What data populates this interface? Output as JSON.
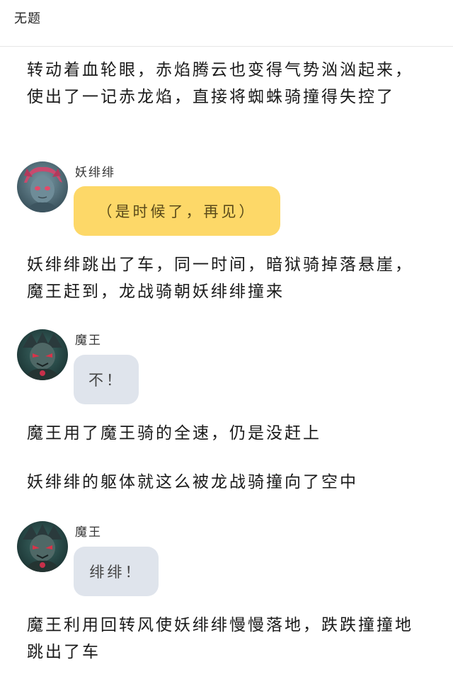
{
  "header": {
    "title": "无题"
  },
  "story": [
    {
      "kind": "narration",
      "text": "转动着血轮眼，赤焰腾云也变得气势汹汹起来，使出了一记赤龙焰，直接将蜘蛛骑撞得失控了"
    },
    {
      "kind": "dialog",
      "speaker": "妖绯绯",
      "avatar_icon": "yao-feifei-avatar",
      "text": "（是时候了，再见）",
      "bubble_color": "#fdd868"
    },
    {
      "kind": "narration",
      "text": "妖绯绯跳出了车，同一时间，暗狱骑掉落悬崖，魔王赶到，龙战骑朝妖绯绯撞来"
    },
    {
      "kind": "dialog",
      "speaker": "魔王",
      "avatar_icon": "mowang-avatar",
      "text": "不！",
      "bubble_color": "#dfe4ec"
    },
    {
      "kind": "narration",
      "text": "魔王用了魔王骑的全速，仍是没赶上"
    },
    {
      "kind": "narration",
      "text": "妖绯绯的躯体就这么被龙战骑撞向了空中"
    },
    {
      "kind": "dialog",
      "speaker": "魔王",
      "avatar_icon": "mowang-avatar",
      "text": "绯绯！",
      "bubble_color": "#dfe4ec"
    },
    {
      "kind": "narration",
      "text": "魔王利用回转风使妖绯绯慢慢落地，跌跌撞撞地跳出了车"
    }
  ]
}
